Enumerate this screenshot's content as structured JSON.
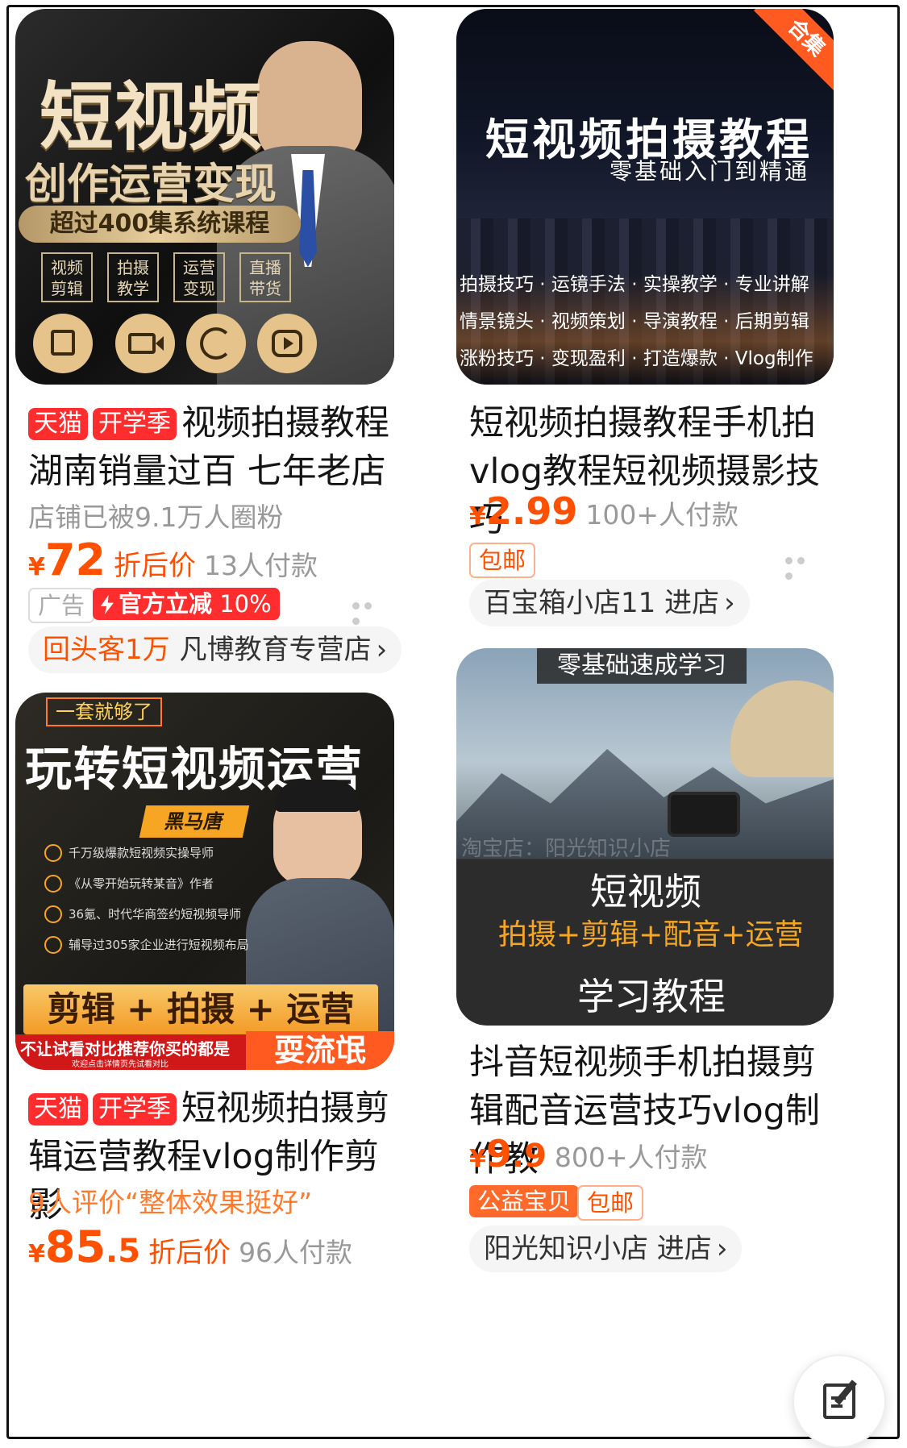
{
  "products": [
    {
      "id": "p1",
      "thumb": {
        "headline": "短视频",
        "subhead": "创作运营变现",
        "banner": "超过400集系统课程",
        "boxes": [
          "视频\n剪辑",
          "拍摄\n教学",
          "运营\n变现",
          "直播\n带货"
        ]
      },
      "tags": [
        "天猫",
        "开学季"
      ],
      "title": "视频拍摄教程湖南销量过百 七年老店",
      "meta": "店铺已被9.1万人圈粉",
      "price": {
        "yen": "¥",
        "int": "72",
        "dec": "",
        "label": "折后价",
        "sold": "13人付款"
      },
      "badges": {
        "ad": "广告",
        "promo": "官方立减",
        "promo_value": "10%"
      },
      "store": {
        "highlight": "回头客1万",
        "name": "凡博教育专营店",
        "arrow": "›"
      }
    },
    {
      "id": "p2",
      "thumb": {
        "corner": "合集",
        "headline": "短视频拍摄教程",
        "subhead": "零基础入门到精通",
        "lines": [
          "拍摄技巧 · 运镜手法 · 实操教学 · 专业讲解",
          "情景镜头 · 视频策划 · 导演教程 · 后期剪辑",
          "涨粉技巧 · 变现盈利 · 打造爆款 · Vlog制作"
        ]
      },
      "title": "短视频拍摄教程手机拍vlog教程短视频摄影技巧",
      "price": {
        "yen": "¥",
        "int": "2.99",
        "dec": "",
        "label": "",
        "sold": "100+人付款"
      },
      "badges": {
        "shipping": "包邮"
      },
      "store": {
        "highlight": "",
        "name": "百宝箱小店11 进店",
        "arrow": "›"
      }
    },
    {
      "id": "p3",
      "thumb": {
        "ribbon": "一套就够了",
        "headline": "玩转短视频运营",
        "name": "黑马唐",
        "bullets": [
          "千万级爆款短视频实操导师",
          "《从零开始玩转某音》作者",
          "36氪、时代华商签约短视频导师",
          "辅导过305家企业进行短视频布局"
        ],
        "bottom": "剪辑 + 拍摄 + 运营",
        "warning": "不让试看对比推荐你买的都是",
        "warning_small": "欢迎点击详情页先试看对比",
        "stamp": "耍流氓"
      },
      "tags": [
        "天猫",
        "开学季"
      ],
      "title": "短视频拍摄剪辑运营教程vlog制作剪影",
      "meta": "9人评价“整体效果挺好”",
      "price": {
        "yen": "¥",
        "int": "85",
        "dec": ".5",
        "label": "折后价",
        "sold": "96人付款"
      }
    },
    {
      "id": "p4",
      "thumb": {
        "top": "零基础速成学习",
        "watermark": "淘宝店：阳光知识小店",
        "line1": "短视频",
        "line2": "拍摄+剪辑+配音+运营",
        "line3": "学习教程"
      },
      "title": "抖音短视频手机拍摄剪辑配音运营技巧vlog制作教",
      "price": {
        "yen": "¥",
        "int": "9",
        "dec": ".9",
        "label": "",
        "sold": "800+人付款"
      },
      "badges": {
        "charity": "公益宝贝",
        "shipping": "包邮"
      },
      "store": {
        "highlight": "",
        "name": "阳光知识小店 进店",
        "arrow": "›"
      }
    }
  ],
  "colors": {
    "accent": "#ff5000",
    "tmall": "#ff2d2d",
    "gold": "#e8b04a"
  },
  "icons": {
    "fab": "edit-note-icon",
    "more": "more-dots-icon",
    "promo": "lightning-icon"
  }
}
